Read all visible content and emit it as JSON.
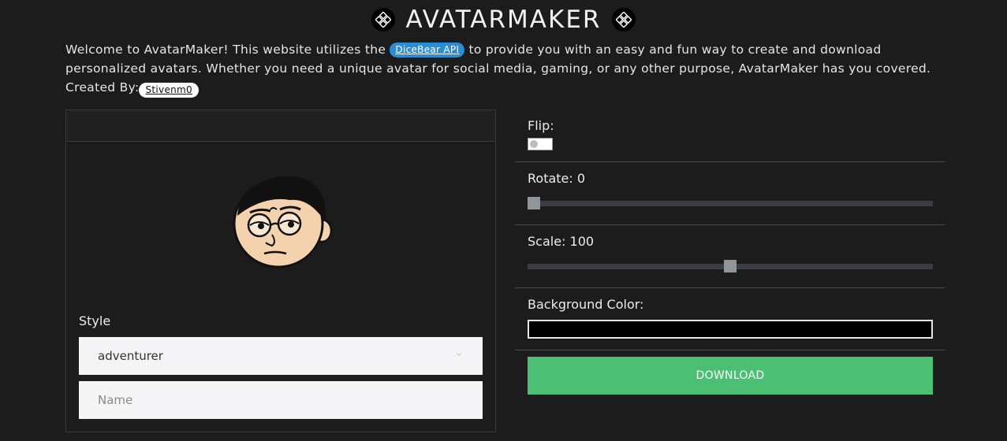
{
  "header": {
    "title": "AVATARMAKER"
  },
  "intro": {
    "text_before_link": "Welcome to AvatarMaker! This website utilizes the ",
    "link_label": "DiceBear API",
    "text_after_link": " to provide you with an easy and fun way to create and download personalized avatars. Whether you need a unique avatar for social media, gaming, or any other purpose, AvatarMaker has you covered.",
    "created_by_label": "Created By:",
    "author": "Stivenm0"
  },
  "form": {
    "style_label": "Style",
    "style_value": "adventurer",
    "name_placeholder": "Name"
  },
  "controls": {
    "flip_label": "Flip:",
    "flip_on": false,
    "rotate_label": "Rotate: 0",
    "rotate_value": 0,
    "scale_label": "Scale: 100",
    "scale_value": 100,
    "background_label": "Background Color:",
    "background_color": "#000000",
    "download_label": "DOWNLOAD"
  },
  "colors": {
    "background": "#1c1c1c",
    "link_pill": "#2a8ed6",
    "download_button": "#4bbf73"
  }
}
